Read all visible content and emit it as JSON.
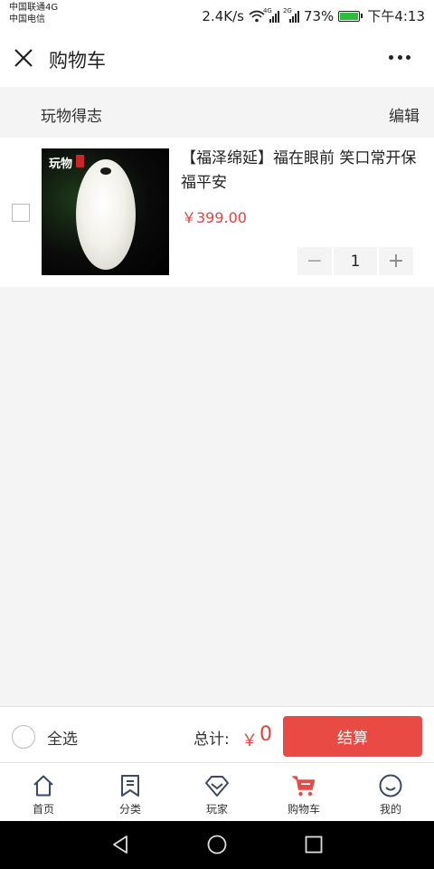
{
  "status_bar": {
    "carrier1": "中国联通4G",
    "carrier2": "中国电信",
    "speed": "2.4K/s",
    "sim1_tag": "4G",
    "sim2_tag": "2G",
    "battery": "73%",
    "time": "下午4:13"
  },
  "header": {
    "title": "购物车"
  },
  "shop": {
    "name": "玩物得志",
    "edit_label": "编辑"
  },
  "item": {
    "brand_mark": "玩物",
    "title": "【福泽绵延】福在眼前 笑口常开保福平安",
    "price": "￥399.00",
    "quantity": "1",
    "minus": "−",
    "plus": "+"
  },
  "checkout": {
    "select_all": "全选",
    "total_label": "总计:",
    "currency": "￥",
    "total_value": "0",
    "checkout_label": "结算"
  },
  "tabs": [
    {
      "label": "首页",
      "icon": "home-icon"
    },
    {
      "label": "分类",
      "icon": "category-icon"
    },
    {
      "label": "玩家",
      "icon": "player-icon"
    },
    {
      "label": "购物车",
      "icon": "cart-icon"
    },
    {
      "label": "我的",
      "icon": "profile-icon"
    }
  ],
  "colors": {
    "accent": "#e94b44",
    "price": "#e8413e",
    "active_tab": "#e94b44"
  }
}
